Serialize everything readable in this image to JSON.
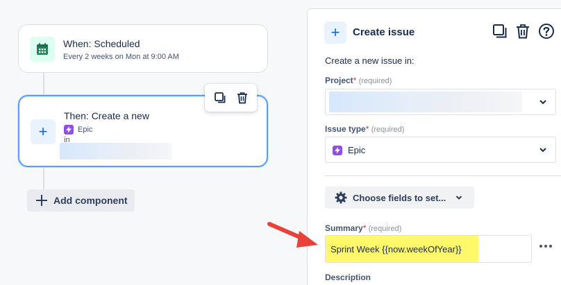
{
  "trigger": {
    "title": "When: Scheduled",
    "subtitle": "Every 2 weeks on Mon at 9:00 AM",
    "icon": "calendar-icon"
  },
  "action": {
    "title": "Then: Create a new",
    "issue_type": "Epic",
    "in_label": "in",
    "icon": "plus-icon"
  },
  "card_toolbar": {
    "copy_icon": "copy-icon",
    "delete_icon": "trash-icon"
  },
  "add_component_label": "Add component",
  "panel": {
    "title": "Create issue",
    "intro": "Create a new issue in:",
    "project_label": "Project",
    "required_text": "(required)",
    "issue_type_label": "Issue type",
    "issue_type_value": "Epic",
    "choose_fields_label": "Choose fields to set...",
    "summary_label": "Summary",
    "summary_value": "Sprint Week {{now.weekOfYear}}",
    "description_label": "Description"
  },
  "colors": {
    "accent": "#0c66e4",
    "epic": "#904ee2",
    "highlight": "#fff86b",
    "arrow": "#e8413a"
  }
}
